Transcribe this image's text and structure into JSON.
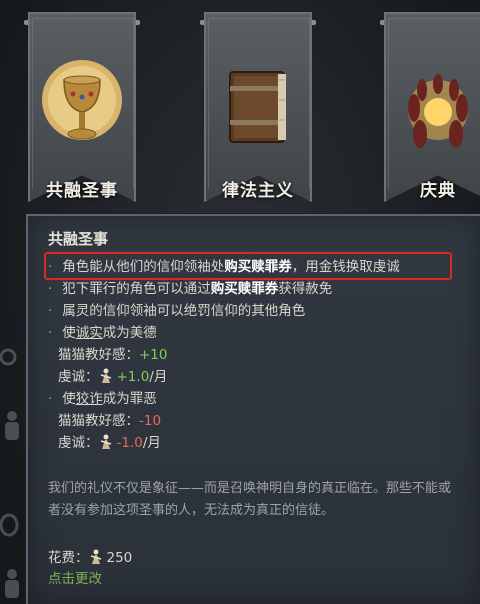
{
  "banners": [
    {
      "label": "共融圣事",
      "icon": "chalice-icon"
    },
    {
      "label": "律法主义",
      "icon": "law-book-icon"
    },
    {
      "label": "庆典",
      "icon": "ritual-circle-icon"
    }
  ],
  "tooltip": {
    "title": "共融圣事",
    "line1": {
      "pre": "角色能从他们的信仰领袖处",
      "hl": "购买赎罪券",
      "post": "，用金钱换取虔诚"
    },
    "line2": {
      "pre": "犯下罪行的角色可以通过",
      "hl": "购买赎罪券",
      "post": "获得赦免"
    },
    "line3": "属灵的信仰领袖可以绝罚信仰的其他角色",
    "virtue": {
      "pre": "使",
      "word": "诚实",
      "post": "成为美德",
      "opinion_label": "猫猫教好感：",
      "opinion_value": "+10",
      "piety_label": "虔诚：",
      "piety_value": "+1.0",
      "per_month": "/月"
    },
    "sin": {
      "pre": "使",
      "word": "狡诈",
      "post": "成为罪恶",
      "opinion_label": "猫猫教好感：",
      "opinion_value": "-10",
      "piety_label": "虔诚：",
      "piety_value": "-1.0",
      "per_month": "/月"
    },
    "flavor": "我们的礼仪不仅是象征——而是召唤神明自身的真正临在。那些不能或者没有参加这项圣事的人，无法成为真正的信徒。",
    "cost_label": "花费：",
    "cost_value": "250",
    "change_link": "点击更改"
  },
  "colors": {
    "highlight_box": "#e0261e",
    "positive": "#7fcf5a",
    "negative": "#e56a5a",
    "link": "#7fb04e"
  }
}
